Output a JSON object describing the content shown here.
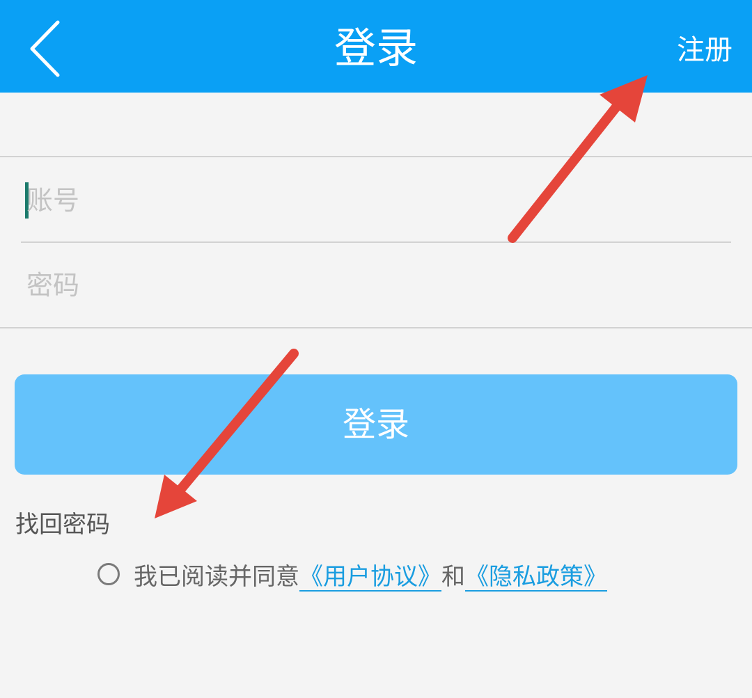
{
  "header": {
    "title": "登录",
    "register_label": "注册",
    "back_icon": "chevron-left-icon"
  },
  "form": {
    "account_placeholder": "账号",
    "password_placeholder": "密码",
    "login_label": "登录"
  },
  "links": {
    "find_password": "找回密码"
  },
  "agreement": {
    "prefix": "我已阅读并同意",
    "user_agreement": "《用户协议》",
    "conjunction": "和",
    "privacy_policy": "《隐私政策》"
  },
  "colors": {
    "header_bg": "#0aa0f5",
    "button_bg": "#64c2fb",
    "link": "#1a9de0",
    "annotation_arrow": "#e5453a",
    "page_bg": "#f4f4f4"
  }
}
